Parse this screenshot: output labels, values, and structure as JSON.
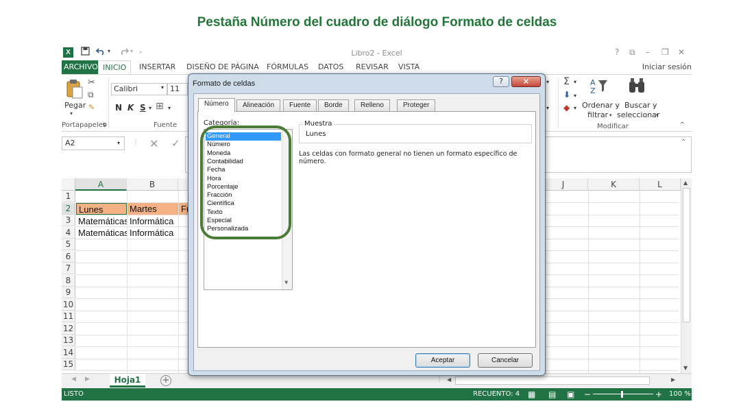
{
  "caption": "Pestaña Número del cuadro de diálogo Formato de celdas",
  "window": {
    "title": "Libro2 - Excel",
    "logo": "X",
    "controls": [
      "?",
      "⧉",
      "–",
      "❐",
      "✕"
    ]
  },
  "qat_icons": [
    "save-icon",
    "undo-icon",
    "redo-icon",
    "customize-icon"
  ],
  "tabs": [
    {
      "label": "ARCHIVO"
    },
    {
      "label": "INICIO"
    },
    {
      "label": "INSERTAR"
    },
    {
      "label": "DISEÑO DE PÁGINA"
    },
    {
      "label": "FÓRMULAS"
    },
    {
      "label": "DATOS"
    },
    {
      "label": "REVISAR"
    },
    {
      "label": "VISTA"
    }
  ],
  "signin": "Iniciar sesión",
  "ribbon": {
    "paste_label": "Pegar",
    "clipboard_group": "Portapapeles",
    "font_name": "Calibri",
    "font_size": "11",
    "bold": "N",
    "italic": "K",
    "underline": "S",
    "font_group": "Fuente",
    "sort_label_1": "Ordenar y",
    "sort_label_2": "filtrar",
    "find_label_1": "Buscar y",
    "find_label_2": "seleccionar",
    "modify_group": "Modificar"
  },
  "formula_bar": {
    "name_box": "A2",
    "cancel": "✕",
    "enter": "✓"
  },
  "grid": {
    "columns_left": [
      "A",
      "B"
    ],
    "columns_right": [
      "J",
      "K",
      "L"
    ],
    "rows": [
      "1",
      "2",
      "3",
      "4",
      "5",
      "6",
      "7",
      "8",
      "9",
      "10",
      "11",
      "12",
      "13",
      "14",
      "15"
    ],
    "cells": {
      "a2": "Lunes",
      "b2": "Martes",
      "c2": "Fr",
      "a3": "Matemáticas",
      "b3": "Informática",
      "a4": "Matemáticas",
      "b4": "Informática"
    },
    "highlight_color": "#f4b183"
  },
  "sheet_tab": "Hoja1",
  "status": {
    "mode": "LISTO",
    "count": "RECUENTO: 4",
    "zoom": "100 %"
  },
  "dialog": {
    "title": "Formato de celdas",
    "help": "?",
    "close": "✕",
    "tabs": [
      "Número",
      "Alineación",
      "Fuente",
      "Borde",
      "Relleno",
      "Proteger"
    ],
    "category_label": "Categoría:",
    "categories": [
      "General",
      "Número",
      "Moneda",
      "Contabilidad",
      "Fecha",
      "Hora",
      "Porcentaje",
      "Fracción",
      "Científica",
      "Texto",
      "Especial",
      "Personalizada"
    ],
    "selected_category": "General",
    "sample_label": "Muestra",
    "sample_value": "Lunes",
    "description": "Las celdas con formato general no tienen un formato específico de número.",
    "ok": "Aceptar",
    "cancel": "Cancelar"
  },
  "colors": {
    "excel_green": "#217346",
    "annotation_ring": "#4b7c35",
    "selection_blue": "#3399ff"
  }
}
